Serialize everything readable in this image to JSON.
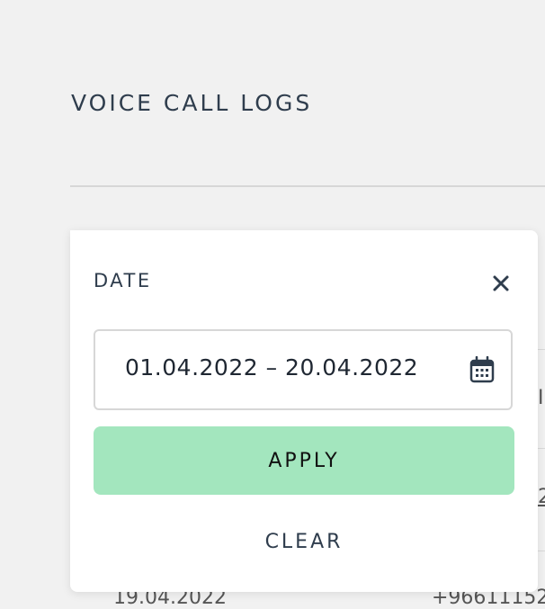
{
  "page": {
    "title": "VOICE CALL LOGS"
  },
  "table": {
    "cells": [
      "I",
      "2",
      "19.04.2022",
      "+96611152"
    ]
  },
  "filter_popover": {
    "title": "DATE",
    "close_icon": "close-icon",
    "date_range": "01.04.2022 – 20.04.2022",
    "calendar_icon": "calendar-icon",
    "apply_label": "APPLY",
    "clear_label": "CLEAR"
  },
  "colors": {
    "background": "#f1f1f1",
    "panel": "#ffffff",
    "text": "#2f3d4d",
    "apply_button": "#a3e6be",
    "divider": "#d7d7d7"
  }
}
